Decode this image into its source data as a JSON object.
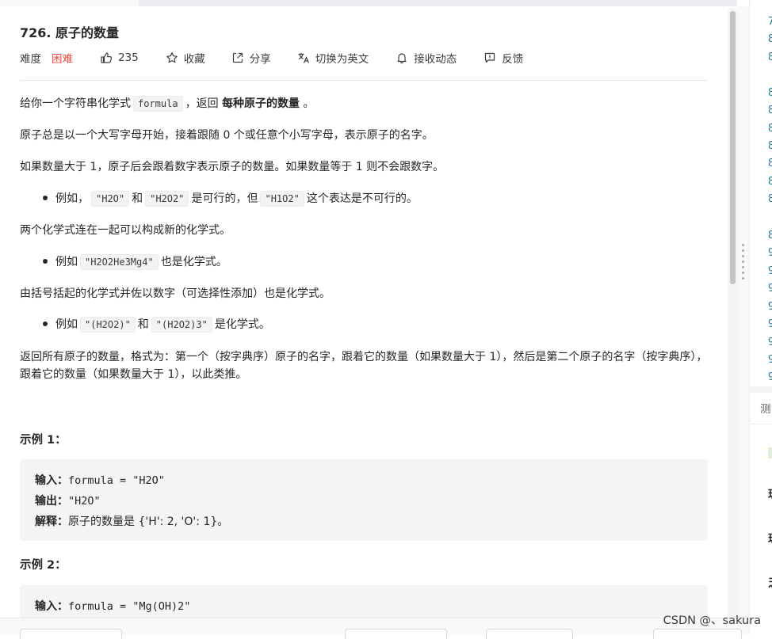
{
  "problem": {
    "title": "726. 原子的数量",
    "difficulty_label": "难度",
    "difficulty_value": "困难",
    "likes": "235",
    "collect": "收藏",
    "share": "分享",
    "translate": "切换为英文",
    "notify": "接收动态",
    "feedback": "反馈"
  },
  "description": {
    "p1_a": "给你一个字符串化学式",
    "p1_code": "formula",
    "p1_b": "，返回",
    "p1_strong": "每种原子的数量",
    "p1_c": "。",
    "p2": "原子总是以一个大写字母开始，接着跟随 0 个或任意个小写字母，表示原子的名字。",
    "p3": "如果数量大于 1，原子后会跟着数字表示原子的数量。如果数量等于 1 则不会跟数字。",
    "b1_a": "例如，",
    "b1_code1": "\"H2O\"",
    "b1_b": "和",
    "b1_code2": "\"H2O2\"",
    "b1_c": "是可行的，但",
    "b1_code3": "\"H1O2\"",
    "b1_d": "这个表达是不可行的。",
    "p4": "两个化学式连在一起可以构成新的化学式。",
    "b2_a": "例如",
    "b2_code": "\"H2O2He3Mg4\"",
    "b2_b": "也是化学式。",
    "p5": "由括号括起的化学式并佐以数字（可选择性添加）也是化学式。",
    "b3_a": "例如",
    "b3_code1": "\"(H2O2)\"",
    "b3_b": "和",
    "b3_code2": "\"(H2O2)3\"",
    "b3_c": "是化学式。",
    "p6": "返回所有原子的数量，格式为：第一个（按字典序）原子的名字，跟着它的数量（如果数量大于 1），然后是第二个原子的名字（按字典序），跟着它的数量（如果数量大于 1），以此类推。"
  },
  "examples": [
    {
      "title": "示例 1：",
      "input_label": "输入：",
      "input_value": "formula = \"H2O\"",
      "output_label": "输出：",
      "output_value": "\"H2O\"",
      "explain_label": "解释：",
      "explain_value": "原子的数量是 {'H': 2, 'O': 1}。"
    },
    {
      "title": "示例 2：",
      "input_label": "输入：",
      "input_value": "formula = \"Mg(OH)2\""
    }
  ],
  "editor": {
    "line_numbers": [
      "7",
      "8",
      "8",
      "8",
      "8",
      "8",
      "8",
      "8",
      "8",
      "8",
      "8",
      "9",
      "9",
      "9",
      "9",
      "9",
      "9",
      "9",
      "9"
    ],
    "tab_label": "测",
    "glyphs": [
      "理",
      "理",
      "乏"
    ]
  },
  "watermark": "CSDN @、sakura"
}
